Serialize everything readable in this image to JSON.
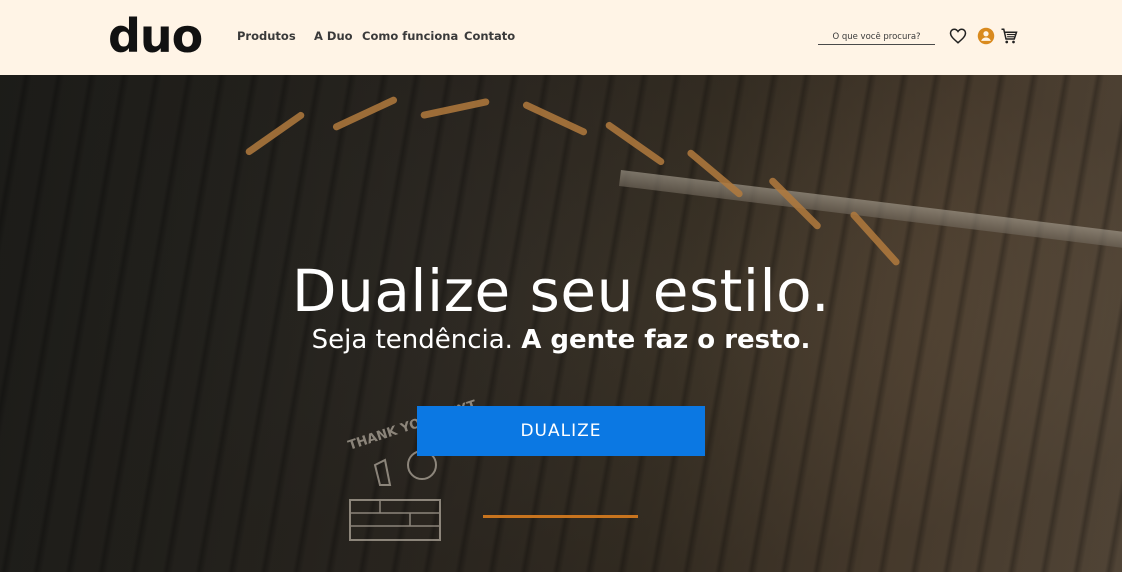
{
  "header": {
    "logo": "duo",
    "nav": [
      "Produtos",
      "A Duo",
      "Como funciona",
      "Contato"
    ],
    "search_placeholder": "O que você procura?",
    "icons": [
      "heart-icon",
      "user-icon",
      "cart-icon"
    ]
  },
  "hero": {
    "title": "Dualize seu estilo.",
    "subtitle_regular": "Seja tendência.",
    "subtitle_bold": "A gente faz o resto.",
    "cta_label": "DUALIZE",
    "print_text": "THANK YOU, NEXT"
  },
  "colors": {
    "header_bg": "#fff4e6",
    "cta": "#0b78e3",
    "accent_line": "#c8741e",
    "user_icon": "#d98a1e"
  }
}
